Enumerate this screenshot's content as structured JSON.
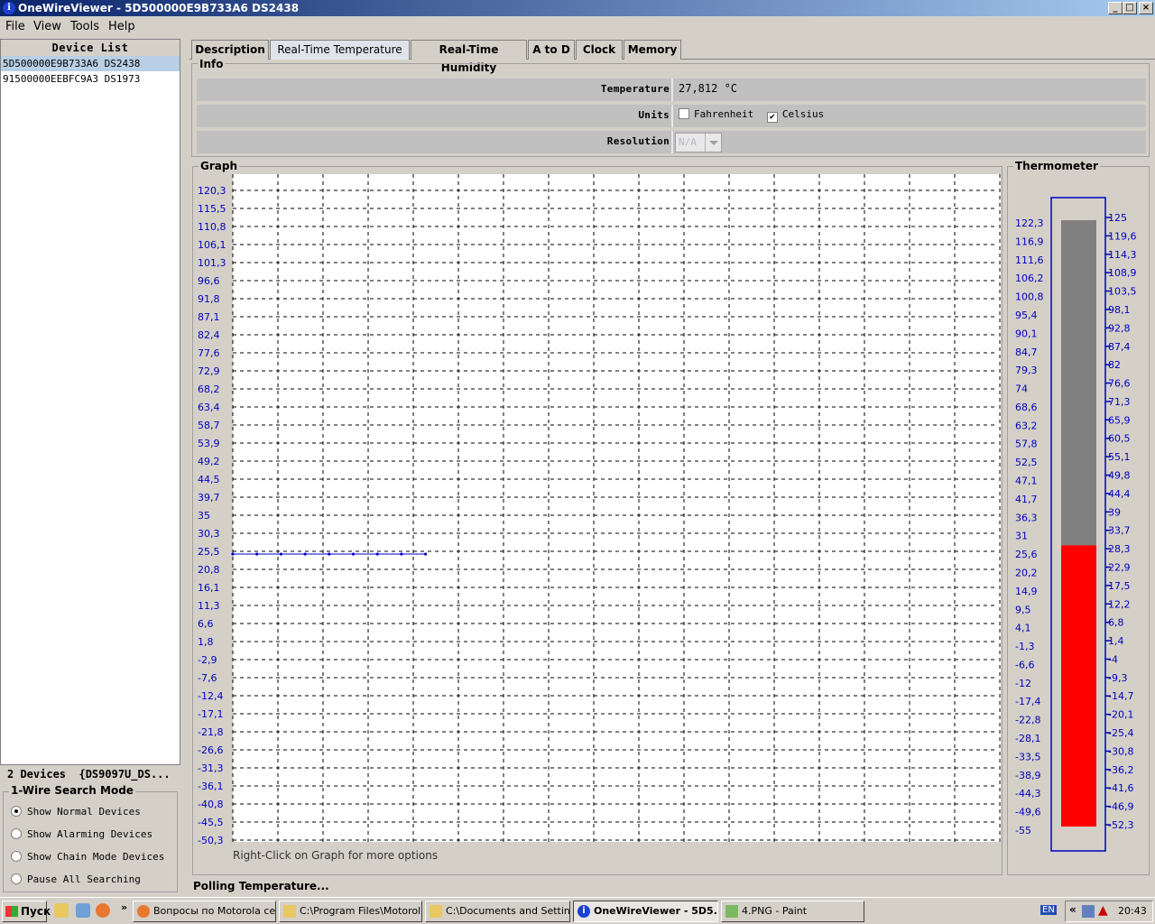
{
  "window": {
    "title": "OneWireViewer - 5D500000E9B733A6 DS2438"
  },
  "menu": [
    "File",
    "View",
    "Tools",
    "Help"
  ],
  "device_list": {
    "header": "Device List",
    "items": [
      "5D500000E9B733A6 DS2438",
      "91500000EEBFC9A3 DS1973"
    ],
    "selected_index": 0,
    "count_label": "2 Devices  {DS9097U_DS..."
  },
  "search_mode": {
    "title": "1-Wire Search Mode",
    "options": [
      {
        "label": "Show Normal Devices",
        "selected": true
      },
      {
        "label": "Show Alarming Devices",
        "selected": false
      },
      {
        "label": "Show Chain Mode Devices",
        "selected": false
      },
      {
        "label": "Pause All Searching",
        "selected": false
      }
    ]
  },
  "tabs": [
    {
      "label": "Description",
      "active": false
    },
    {
      "label": "Real-Time Temperature",
      "active": true
    },
    {
      "label": "Real-Time Humidity",
      "active": false
    },
    {
      "label": "A to D",
      "active": false
    },
    {
      "label": "Clock",
      "active": false
    },
    {
      "label": "Memory",
      "active": false
    }
  ],
  "info": {
    "title": "Info",
    "temperature_label": "Temperature",
    "temperature_value": "27,812 °C",
    "units_label": "Units",
    "fahrenheit_label": "Fahrenheit",
    "fahrenheit_checked": false,
    "celsius_label": "Celsius",
    "celsius_checked": true,
    "resolution_label": "Resolution",
    "resolution_value": "N/A"
  },
  "graph": {
    "title": "Graph",
    "hint": "Right-Click on Graph for more options"
  },
  "chart_data": {
    "type": "line",
    "y_ticks": [
      "120,3",
      "115,5",
      "110,8",
      "106,1",
      "101,3",
      "96,6",
      "91,8",
      "87,1",
      "82,4",
      "77,6",
      "72,9",
      "68,2",
      "63,4",
      "58,7",
      "53,9",
      "49,2",
      "44,5",
      "39,7",
      "35",
      "30,3",
      "25,5",
      "20,8",
      "16,1",
      "11,3",
      "6,6",
      "1,8",
      "-2,9",
      "-7,6",
      "-12,4",
      "-17,1",
      "-21,8",
      "-26,6",
      "-31,3",
      "-36,1",
      "-40,8",
      "-45,5",
      "-50,3"
    ],
    "ylim": [
      -50.3,
      120.3
    ],
    "grid": true,
    "series": [
      {
        "values": [
          24.8,
          24.8,
          24.8,
          24.8,
          24.8,
          24.8,
          24.8,
          24.8,
          24.8
        ]
      }
    ],
    "color": "#0000c0"
  },
  "thermometer": {
    "title": "Thermometer",
    "left_scale": [
      "122,3",
      "116,9",
      "111,6",
      "106,2",
      "100,8",
      "95,4",
      "90,1",
      "84,7",
      "79,3",
      "74",
      "68,6",
      "63,2",
      "57,8",
      "52,5",
      "47,1",
      "41,7",
      "36,3",
      "31",
      "25,6",
      "20,2",
      "14,9",
      "9,5",
      "4,1",
      "-1,3",
      "-6,6",
      "-12",
      "-17,4",
      "-22,8",
      "-28,1",
      "-33,5",
      "-38,9",
      "-44,3",
      "-49,6",
      "-55"
    ],
    "right_scale": [
      "125",
      "119,6",
      "114,3",
      "108,9",
      "103,5",
      "98,1",
      "92,8",
      "87,4",
      "82",
      "76,6",
      "71,3",
      "65,9",
      "60,5",
      "55,1",
      "49,8",
      "44,4",
      "39",
      "33,7",
      "28,3",
      "22,9",
      "17,5",
      "12,2",
      "6,8",
      "1,4",
      "-4",
      "-9,3",
      "-14,7",
      "-20,1",
      "-25,4",
      "-30,8",
      "-36,2",
      "-41,6",
      "-46,9",
      "-52,3"
    ],
    "min": -55,
    "max": 125,
    "value": 27.812,
    "fill_color": "#ff0000",
    "empty_color": "#808080",
    "frame_color": "#0000c0"
  },
  "status": "Polling Temperature...",
  "taskbar": {
    "start_label": "Пуск",
    "buttons": [
      {
        "label": "Вопросы по Motorola ce...",
        "active": false
      },
      {
        "label": "C:\\Program Files\\Motorol...",
        "active": false
      },
      {
        "label": "C:\\Documents and Settin...",
        "active": false
      },
      {
        "label": "OneWireViewer - 5D5...",
        "active": true
      },
      {
        "label": "4.PNG - Paint",
        "active": false
      }
    ],
    "lang": "EN",
    "clock": "20:43"
  }
}
